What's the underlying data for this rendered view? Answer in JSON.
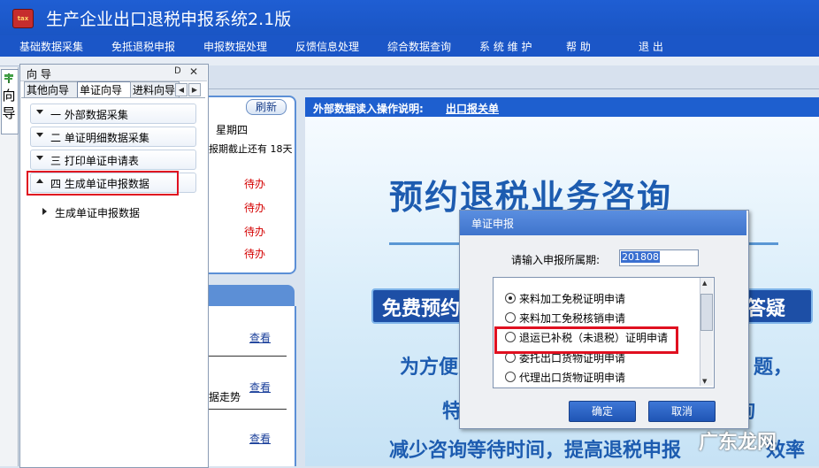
{
  "app": {
    "title": "生产企业出口退税申报系统2.1版",
    "icon_text": "tax",
    "accent": "#1f5ed3"
  },
  "menu": [
    "基础数据采集",
    "免抵退税申报",
    "申报数据处理",
    "反馈信息处理",
    "综合数据查询",
    "系 统 维 护",
    "帮  助",
    "退  出"
  ],
  "side_tab": {
    "label": "向导",
    "icon": "signpost-icon"
  },
  "guide_panel": {
    "title": "向 导",
    "pin_icon": "pin-icon",
    "close_icon": "close-icon",
    "tabs": [
      "其他向导",
      "单证向导",
      "进料向导"
    ],
    "active_tab": "单证向导",
    "steps": [
      {
        "label": "一  外部数据采集",
        "expanded": false
      },
      {
        "label": "二  单证明细数据采集",
        "expanded": false
      },
      {
        "label": "三  打印单证申请表",
        "expanded": false
      },
      {
        "label": "四  生成单证申报数据",
        "expanded": true
      }
    ],
    "sub_item": "生成单证申报数据"
  },
  "middle": {
    "refresh": "刷新",
    "weekday": "星期四",
    "deadline": "报期截止还有 18天",
    "todos": [
      "待办",
      "待办",
      "待办",
      "待办"
    ],
    "links": [
      "查看",
      "查看",
      "查看"
    ],
    "trend": "据走势"
  },
  "right": {
    "read_label": "外部数据读入操作说明:",
    "read_link": "出口报关单",
    "poster_title": "预约退税业务咨询",
    "poster_banner_a": "免费预约",
    "poster_banner_b": "松答疑",
    "poster_lines": [
      "为方便",
      "题，",
      "特",
      "询",
      "减少咨询等待时间，提高退税申报",
      "效率"
    ],
    "watermark": "广东龙网"
  },
  "dialog": {
    "title": "单证申报",
    "period_label": "请输入申报所属期:",
    "period_value": "201808",
    "options": [
      {
        "label": "来料加工免税证明申请",
        "selected": true
      },
      {
        "label": "来料加工免税核销申请",
        "selected": false
      },
      {
        "label": "退运已补税（未退税）证明申请",
        "selected": false
      },
      {
        "label": "委托出口货物证明申请",
        "selected": false
      },
      {
        "label": "代理出口货物证明申请",
        "selected": false
      }
    ],
    "ok": "确定",
    "cancel": "取消"
  }
}
